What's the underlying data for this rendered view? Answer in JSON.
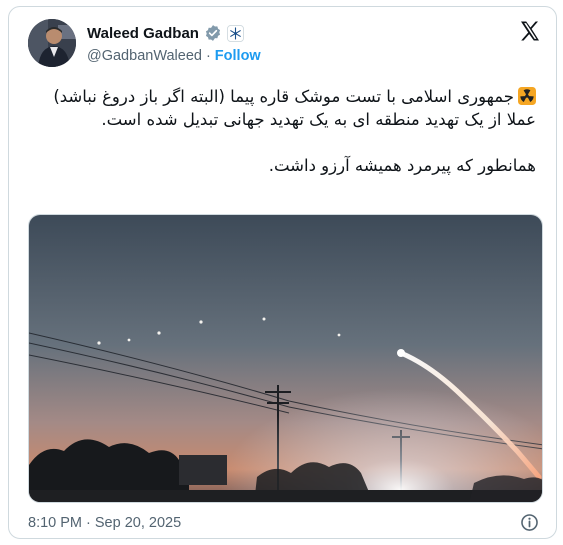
{
  "author": {
    "display_name": "Waleed Gadban",
    "handle": "@GadbanWaleed",
    "separator": "·",
    "follow_label": "Follow"
  },
  "tweet": {
    "line1": "جمهوری اسلامی با تست موشک قاره پیما (البته اگر باز دروغ نباشد) عملا از یک تهدید منطقه ای به یک تهدید جهانی تبدیل شده است.",
    "line2": "همانطور که پیرمرد همیشه آرزو داشت."
  },
  "footer": {
    "timestamp": "8:10 PM · Sep 20, 2025"
  },
  "icons": {
    "verified": "verified-badge-icon",
    "affiliate": "snowflake-affiliate-icon",
    "logo": "x-logo-icon",
    "emoji": "radioactive-icon",
    "info": "info-icon"
  },
  "colors": {
    "link": "#1d9bf0",
    "muted": "#536471",
    "border": "#cfd9de",
    "verified": "#829aab"
  }
}
